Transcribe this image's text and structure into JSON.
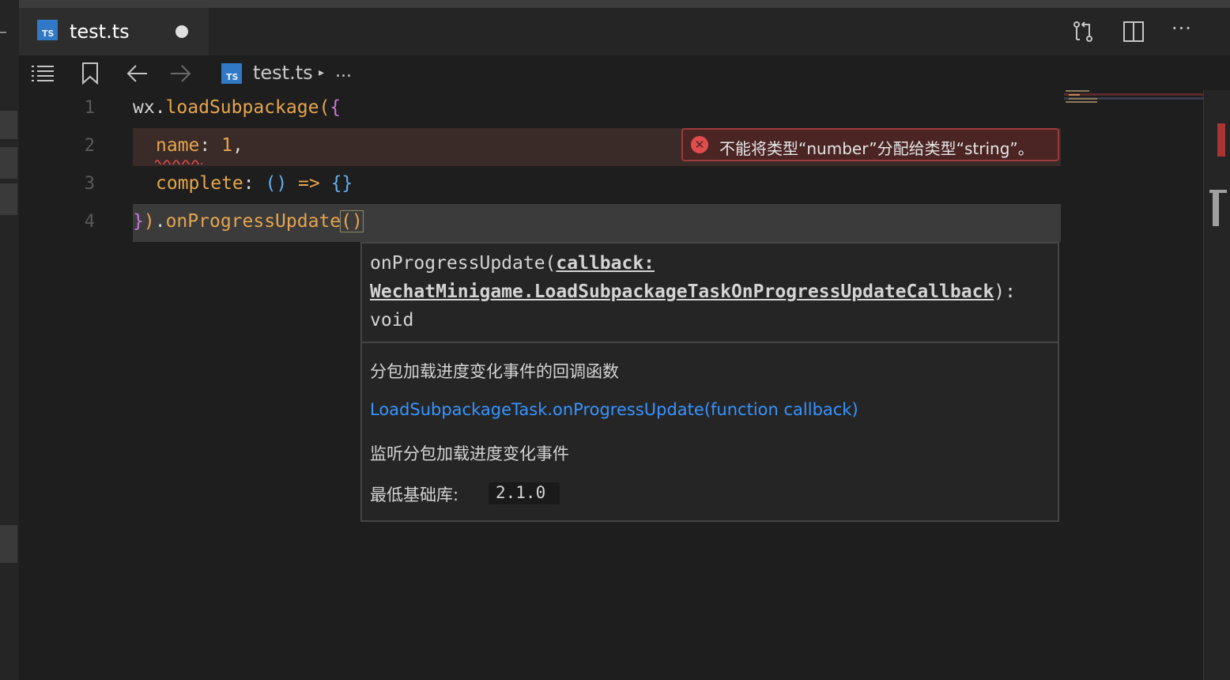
{
  "tab": {
    "title": "test.ts",
    "lang_badge": "TS"
  },
  "breadcrumb": {
    "file": "test.ts",
    "separator": "▸",
    "more": "..."
  },
  "toolbar": {
    "more_label": "···"
  },
  "line_numbers": [
    "1",
    "2",
    "3",
    "4"
  ],
  "code": {
    "l1_obj": "wx",
    "l1_dot": ".",
    "l1_fn": "loadSubpackage",
    "l1_paren": "(",
    "l1_brace": "{",
    "l2_key": "name",
    "l2_colon": ": ",
    "l2_val": "1",
    "l2_comma": ",",
    "l3_key": "complete",
    "l3_colon": ": ",
    "l3_parens": "()",
    "l3_arrow": " => ",
    "l3_braces": "{}",
    "l4_brace": "}",
    "l4_paren": ")",
    "l4_dot": ".",
    "l4_fn": "onProgressUpdate",
    "l4_call": "()"
  },
  "error_popup": {
    "message": "不能将类型“number”分配给类型“string”。"
  },
  "hover": {
    "sig_name": "onProgressUpdate(",
    "sig_param": "callback:",
    "sig_type": "WechatMinigame.LoadSubpackageTaskOnProgressUpdateCallback",
    "sig_close": "):",
    "sig_return": "void",
    "desc": "分包加载进度变化事件的回调函数",
    "link": "LoadSubpackageTask.onProgressUpdate(function callback)",
    "detail": "监听分包加载进度变化事件",
    "min_lib_label": "最低基础库:",
    "min_lib_version": "2.1.0"
  },
  "colors": {
    "editor_bg": "#1e1e1e",
    "error": "#e04c4c",
    "link": "#3794ff",
    "ts_blue": "#3178c6"
  }
}
